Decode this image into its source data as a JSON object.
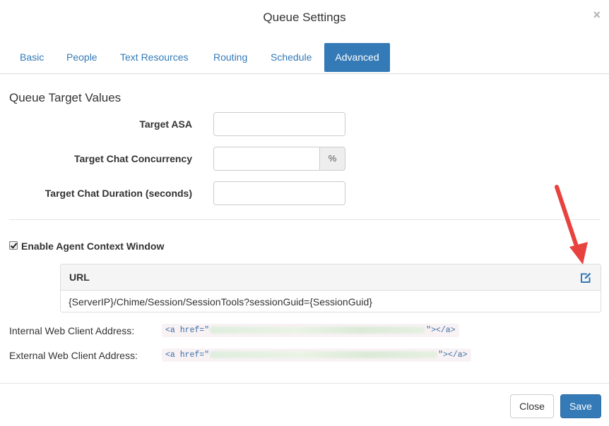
{
  "modal": {
    "title": "Queue Settings",
    "close_glyph": "×"
  },
  "tabs": [
    {
      "label": "Basic",
      "active": false
    },
    {
      "label": "People",
      "active": false
    },
    {
      "label": "Text Resources",
      "active": false
    },
    {
      "label": "Routing",
      "active": false
    },
    {
      "label": "Schedule",
      "active": false
    },
    {
      "label": "Advanced",
      "active": true
    }
  ],
  "targets": {
    "section_title": "Queue Target Values",
    "asa_label": "Target ASA",
    "asa_value": "",
    "concurrency_label": "Target Chat Concurrency",
    "concurrency_value": "",
    "concurrency_addon": "%",
    "duration_label": "Target Chat Duration (seconds)",
    "duration_value": ""
  },
  "context_window": {
    "checkbox_label": "Enable Agent Context Window",
    "checked": true,
    "panel_title": "URL",
    "edit_icon": "edit-icon",
    "url_value": "{ServerIP}/Chime/Session/SessionTools?sessionGuid={SessionGuid}"
  },
  "client_addresses": {
    "internal_label": "Internal Web Client Address:",
    "internal_code_prefix": "<a href=\"",
    "internal_code_suffix": "\"></a>",
    "external_label": "External Web Client Address:",
    "external_code_prefix": "<a href=\"",
    "external_code_suffix": "\"></a>"
  },
  "footer": {
    "close_label": "Close",
    "save_label": "Save"
  },
  "colors": {
    "primary": "#337ab7",
    "annotation_arrow": "#e8423f"
  }
}
